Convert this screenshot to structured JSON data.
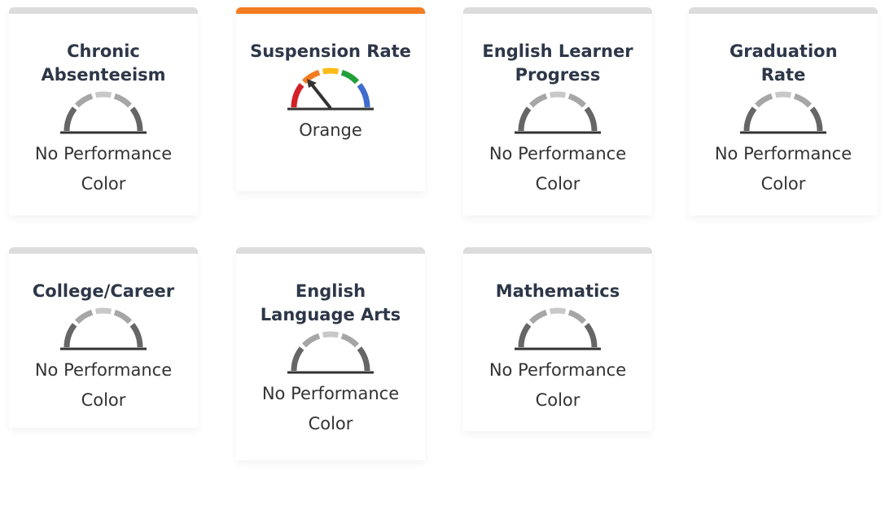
{
  "indicators": [
    {
      "title": "Chronic Absenteeism",
      "status": "No Performance Color",
      "gauge": "no-color-gauge-icon"
    },
    {
      "title": "Suspension Rate",
      "status": "Orange",
      "gauge": "orange-gauge-icon",
      "level": 2,
      "active_color": "#f47c20"
    },
    {
      "title": "English Learner Progress",
      "status": "No Performance Color",
      "gauge": "no-color-gauge-icon"
    },
    {
      "title": "Graduation Rate",
      "status": "No Performance Color",
      "gauge": "no-color-gauge-icon"
    },
    {
      "title": "College/Career",
      "status": "No Performance Color",
      "gauge": "no-color-gauge-icon"
    },
    {
      "title": "English Language Arts",
      "status": "No Performance Color",
      "gauge": "no-color-gauge-icon"
    },
    {
      "title": "Mathematics",
      "status": "No Performance Color",
      "gauge": "no-color-gauge-icon"
    }
  ],
  "colors": {
    "red": "#d42027",
    "orange": "#f47c20",
    "yellow": "#fdbb16",
    "green": "#20a038",
    "blue": "#3f6cce",
    "gray_dark": "#666666",
    "gray_mid": "#a6a6a6",
    "gray_light": "#c8c8c8",
    "inactive_bar": "#dcdcdc"
  }
}
